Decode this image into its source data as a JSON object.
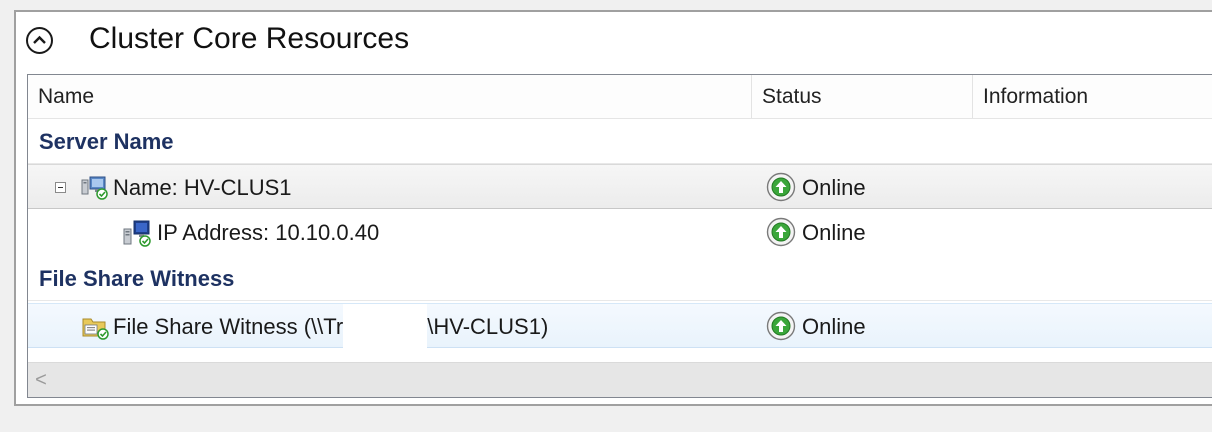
{
  "panel": {
    "title": "Cluster Core Resources",
    "collapse_icon": "chevron-up-icon"
  },
  "columns": [
    "Name",
    "Status",
    "Information"
  ],
  "groups": [
    {
      "label": "Server Name",
      "rows": [
        {
          "name": "Name: HV-CLUS1",
          "status": "Online",
          "icon": "network-name-icon",
          "expanded": true
        },
        {
          "name": "IP Address: 10.10.0.40",
          "status": "Online",
          "icon": "ip-address-icon"
        }
      ]
    },
    {
      "label": "File Share Witness",
      "rows": [
        {
          "name_prefix": "File Share Witness (\\\\Tr",
          "name_suffix": "\\HV-CLUS1)",
          "status": "Online",
          "icon": "file-share-witness-icon"
        }
      ]
    }
  ],
  "scrollbar": {
    "left_arrow": "<"
  },
  "colors": {
    "group_label": "#1e3262",
    "online_green": "#2e9a2e"
  }
}
